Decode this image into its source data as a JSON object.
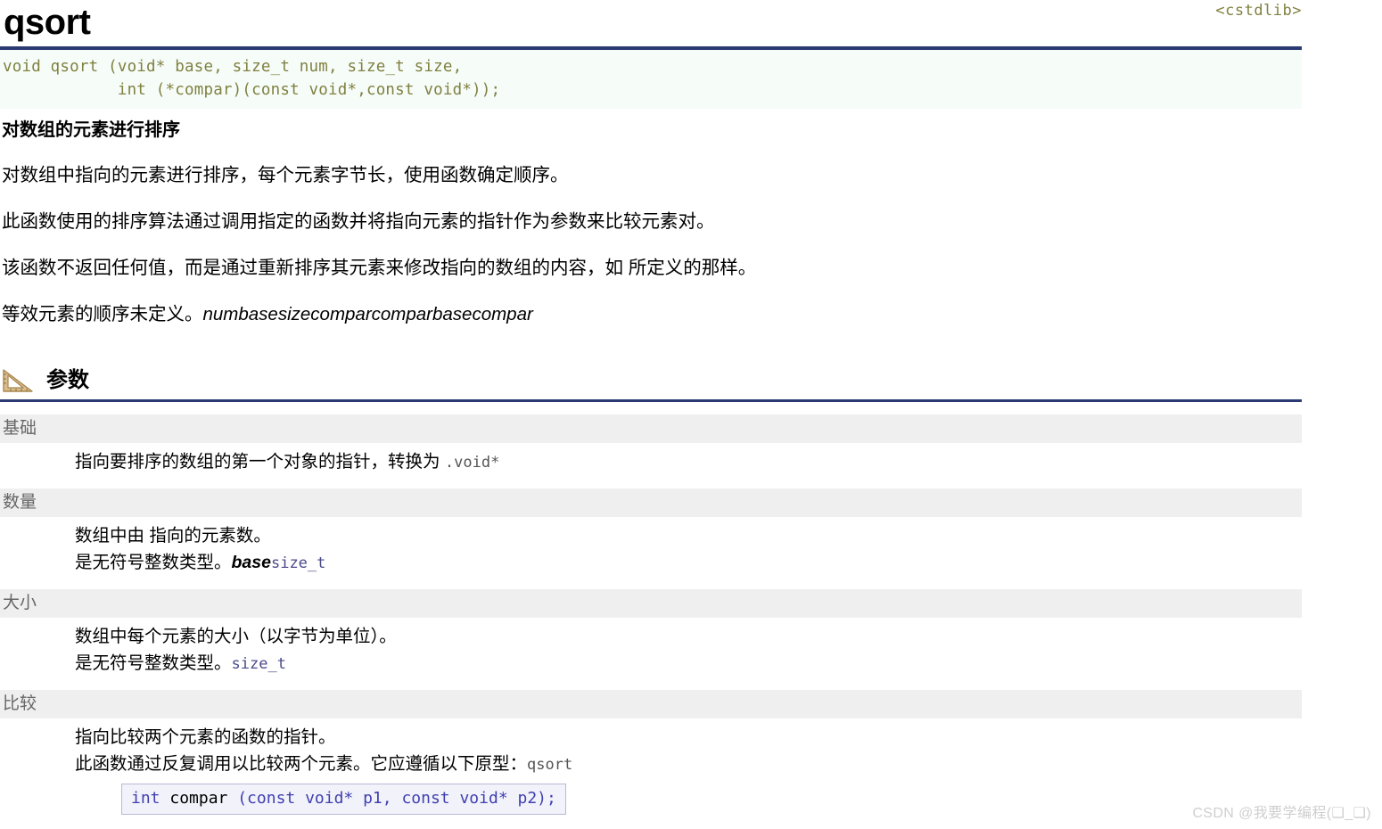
{
  "header": {
    "title": "qsort",
    "include": "<cstdlib>"
  },
  "prototype": {
    "line1": "void qsort (void* base, size_t num, size_t size,",
    "line2": "            int (*compar)(const void*,const void*));"
  },
  "summary": {
    "title": "对数组的元素进行排序",
    "paragraphs": [
      "对数组中指向的元素进行排序，每个元素字节长，使用函数确定顺序。",
      "此函数使用的排序算法通过调用指定的函数并将指向元素的指针作为参数来比较元素对。",
      "该函数不返回任何值，而是通过重新排序其元素来修改指向的数组的内容，如 所定义的那样。"
    ],
    "last_paragraph_text": "等效元素的顺序未定义。",
    "last_paragraph_italic": "numbasesizecomparcomparbasecompar"
  },
  "section": {
    "icon": "ruler-triangle-icon",
    "title": "参数"
  },
  "parameters": [
    {
      "name": "基础",
      "desc_prefix": "指向要排序的数组的第一个对象的指针，转换为 ",
      "desc_mono": ".void*",
      "desc_line2": "",
      "desc_line2_mono": "",
      "desc_line2_italic": ""
    },
    {
      "name": "数量",
      "desc_prefix": "数组中由 指向的元素数。",
      "desc_mono": "",
      "desc_line2": "是无符号整数类型。",
      "desc_line2_italic": "base",
      "desc_line2_mono": "size_t"
    },
    {
      "name": "大小",
      "desc_prefix": "数组中每个元素的大小（以字节为单位）。",
      "desc_mono": "",
      "desc_line2": "是无符号整数类型。",
      "desc_line2_italic": "",
      "desc_line2_mono": "size_t"
    },
    {
      "name": "比较",
      "desc_prefix": "指向比较两个元素的函数的指针。",
      "desc_mono": "",
      "desc_line2": "此函数通过反复调用以比较两个元素。它应遵循以下原型：",
      "desc_line2_italic": "",
      "desc_line2_mono": "qsort"
    }
  ],
  "code_box": {
    "kw1": "int",
    "fn": " compar ",
    "rest": "(const void* p1, const void* p2);"
  },
  "watermark": "CSDN @我要学编程(❑_❑)",
  "colors": {
    "accent_navy": "#2b3a72",
    "code_olive": "#808040",
    "param_gray_bg": "#efefef",
    "param_name": "#666666",
    "codebox_bg": "#f2f2fb",
    "codebox_border": "#b9b9d6",
    "watermark": "#cfcfcf"
  }
}
